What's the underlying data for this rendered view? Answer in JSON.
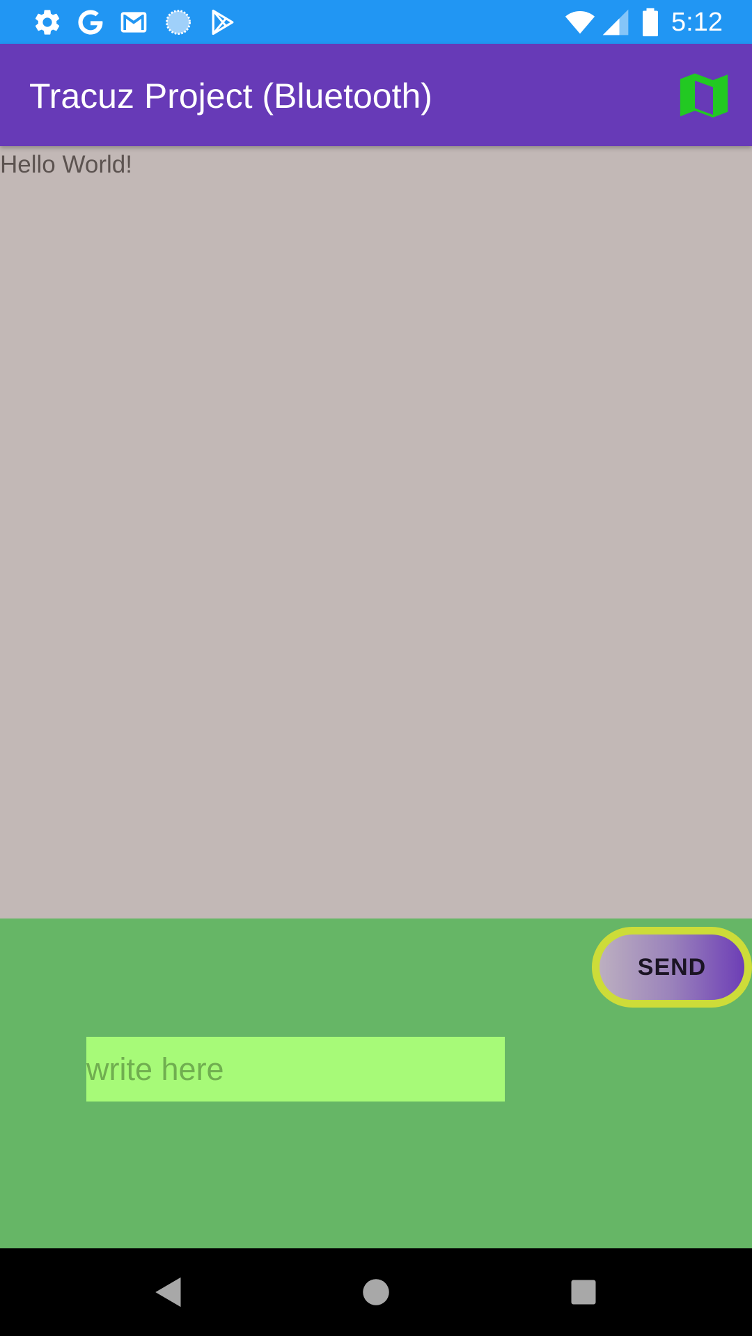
{
  "status_bar": {
    "time": "5:12",
    "left_icons": [
      "settings-icon",
      "google-icon",
      "gmail-icon",
      "loading-icon",
      "play-store-icon"
    ],
    "right_icons": [
      "wifi-icon",
      "signal-icon",
      "battery-icon"
    ],
    "color": "#2196F3"
  },
  "app_bar": {
    "title": "Tracuz Project (Bluetooth)",
    "action_icon": "map-icon",
    "color": "#673AB7",
    "action_color": "#22C922"
  },
  "content": {
    "message_text": "Hello World!",
    "background": "#C2B8B6"
  },
  "bottom_panel": {
    "send_label": "SEND",
    "input_placeholder": "write here",
    "input_value": "",
    "background": "#66B666",
    "input_background": "#A7FA78",
    "button_border_color": "#CDDC39"
  },
  "nav_bar": {
    "buttons": [
      "back-icon",
      "home-icon",
      "recents-icon"
    ]
  }
}
